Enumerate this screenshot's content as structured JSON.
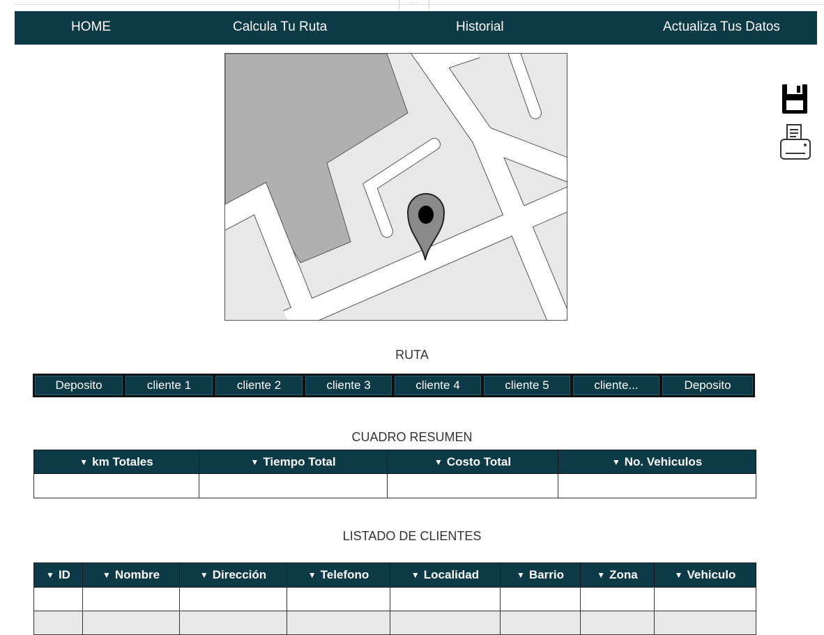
{
  "nav": {
    "items": [
      {
        "label": "HOME"
      },
      {
        "label": "Calcula Tu Ruta"
      },
      {
        "label": "Historial"
      },
      {
        "label": "Actualiza Tus Datos"
      }
    ]
  },
  "tools": {
    "save_icon": "floppy-disk-icon",
    "print_icon": "printer-icon"
  },
  "ruta": {
    "title": "RUTA",
    "stops": [
      "Deposito",
      "cliente 1",
      "cliente 2",
      "cliente 3",
      "cliente 4",
      "cliente 5",
      "cliente...",
      "Deposito"
    ]
  },
  "resumen": {
    "title": "CUADRO RESUMEN",
    "columns": [
      "km Totales",
      "Tiempo Total",
      "Costo Total",
      "No. Vehiculos"
    ],
    "rows": [
      [
        "",
        "",
        "",
        ""
      ]
    ]
  },
  "clientes": {
    "title": "LISTADO DE CLIENTES",
    "columns": [
      "ID",
      "Nombre",
      "Dirección",
      "Telefono",
      "Localidad",
      "Barrio",
      "Zona",
      "Vehiculo"
    ],
    "rows": [
      [
        "",
        "",
        "",
        "",
        "",
        "",
        "",
        ""
      ],
      [
        "",
        "",
        "",
        "",
        "",
        "",
        "",
        ""
      ]
    ]
  },
  "colors": {
    "header_bg": "#0c3a47",
    "header_text": "#ffffff",
    "map_block": "#b0b0b0",
    "map_bg": "#e8e8e8"
  }
}
